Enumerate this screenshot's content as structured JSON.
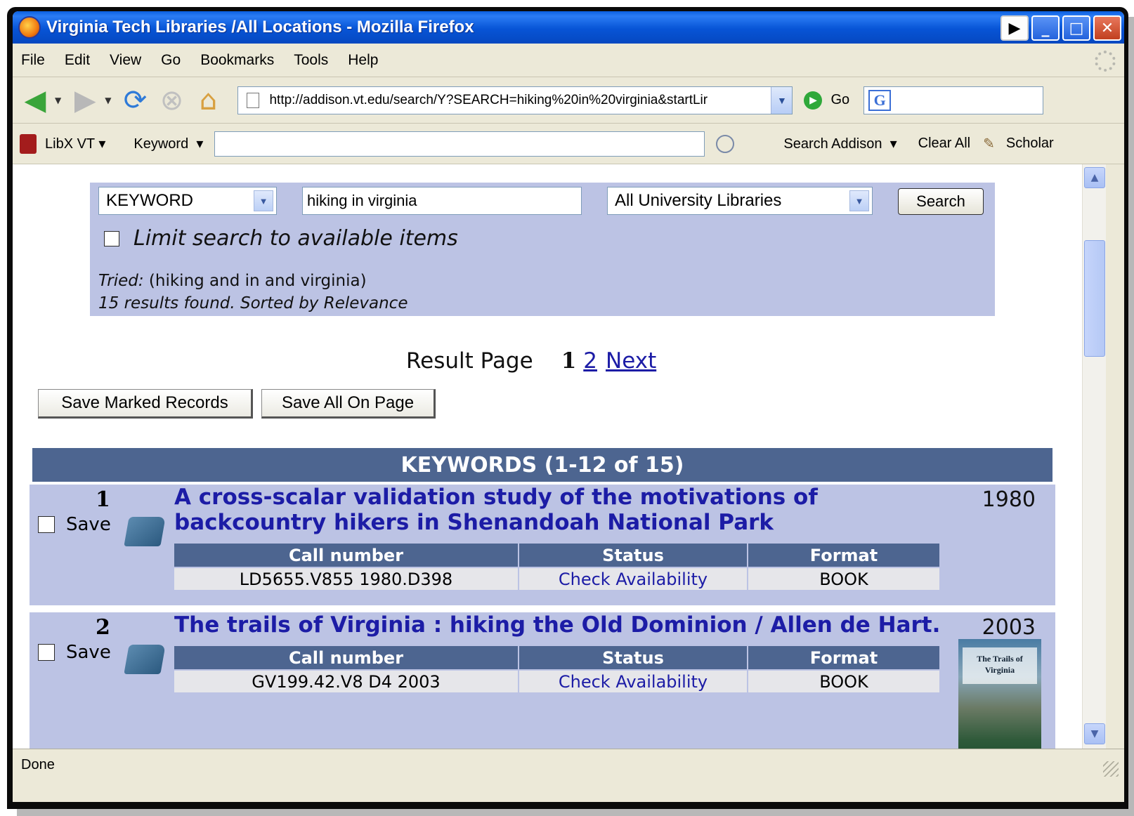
{
  "window": {
    "title": "Virginia Tech Libraries /All Locations - Mozilla Firefox"
  },
  "menu": [
    "File",
    "Edit",
    "View",
    "Go",
    "Bookmarks",
    "Tools",
    "Help"
  ],
  "nav": {
    "url": "http://addison.vt.edu/search/Y?SEARCH=hiking%20in%20virginia&startLir",
    "go_label": "Go",
    "google_letter": "G"
  },
  "libx": {
    "brand": "LibX VT",
    "field": "Keyword",
    "search_label": "Search Addison",
    "clear_label": "Clear All",
    "scholar_label": "Scholar"
  },
  "search": {
    "type": "KEYWORD",
    "query": "hiking in virginia",
    "scope": "All University Libraries",
    "button": "Search",
    "limit_label": "Limit search to available items",
    "tried_label": "Tried:",
    "tried_value": "(hiking and in and virginia)",
    "results_text": "15 results found. Sorted by Relevance"
  },
  "pagination": {
    "label": "Result Page",
    "current": "1",
    "page2": "2",
    "next": "Next"
  },
  "buttons": {
    "save_marked": "Save Marked Records",
    "save_all": "Save All On Page"
  },
  "results_header": "KEYWORDS (1-12 of 15)",
  "holdings_headers": [
    "Call number",
    "Status",
    "Format"
  ],
  "records": [
    {
      "num": "1",
      "save": "Save",
      "title": "A cross-scalar validation study of the motivations of backcountry hikers in Shenandoah National Park",
      "year": "1980",
      "call_number": "LD5655.V855 1980.D398",
      "status": "Check Availability",
      "format": "BOOK"
    },
    {
      "num": "2",
      "save": "Save",
      "title": "The trails of Virginia : hiking the Old Dominion / Allen de Hart.",
      "year": "2003",
      "call_number": "GV199.42.V8 D4 2003",
      "status": "Check Availability",
      "format": "BOOK",
      "cover_text": "The Trails of Virginia"
    }
  ],
  "status_bar": "Done"
}
